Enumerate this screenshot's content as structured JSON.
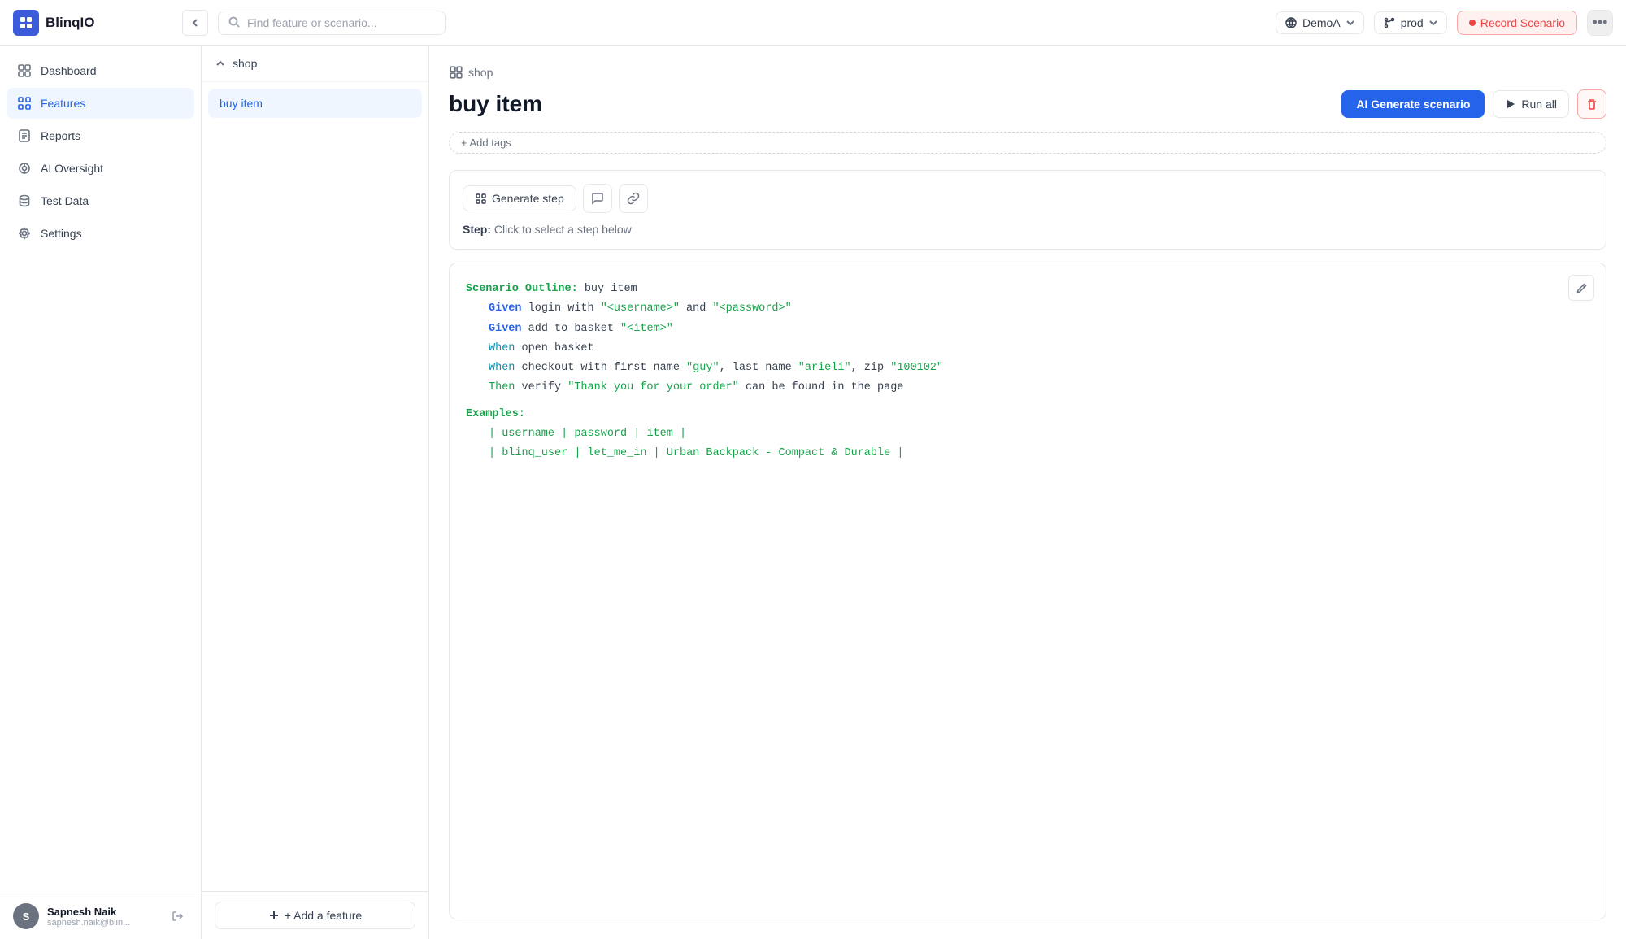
{
  "app": {
    "logo_text": "BlinqIO",
    "search_placeholder": "Find feature or scenario..."
  },
  "header": {
    "env_selector": "DemoA",
    "prod_selector": "prod",
    "record_btn": "Record Scenario",
    "more_icon": "•••"
  },
  "sidebar": {
    "items": [
      {
        "id": "dashboard",
        "label": "Dashboard",
        "active": false
      },
      {
        "id": "features",
        "label": "Features",
        "active": true
      },
      {
        "id": "reports",
        "label": "Reports",
        "active": false
      },
      {
        "id": "ai-oversight",
        "label": "AI Oversight",
        "active": false
      },
      {
        "id": "test-data",
        "label": "Test Data",
        "active": false
      },
      {
        "id": "settings",
        "label": "Settings",
        "active": false
      }
    ],
    "user": {
      "name": "Sapnesh Naik",
      "email": "sapnesh.naik@blin...",
      "initials": "S"
    }
  },
  "middle_panel": {
    "folder": "shop",
    "items": [
      {
        "label": "buy item"
      }
    ],
    "add_feature_label": "+ Add a feature"
  },
  "main": {
    "breadcrumb": "shop",
    "title": "buy item",
    "ai_generate_btn": "AI Generate scenario",
    "run_all_btn": "Run all",
    "add_tags_btn": "+ Add tags",
    "step_area": {
      "generate_step_btn": "Generate step",
      "step_hint_prefix": "Step:",
      "step_hint_text": "Click to select a step below"
    },
    "scenario": {
      "edit_icon": "✏",
      "outline_keyword": "Scenario Outline:",
      "outline_name": " buy item",
      "lines": [
        {
          "keyword": "Given",
          "text": " login with ",
          "string1": "\"<username>\"",
          "mid": " and ",
          "string2": "\"<password>\""
        },
        {
          "keyword": "Given",
          "text": " add to basket ",
          "string1": "\"<item>\""
        },
        {
          "keyword": "When",
          "text": " open basket"
        },
        {
          "keyword": "When",
          "text": " checkout with first name ",
          "string1": "\"guy\"",
          "mid": ", last name ",
          "string2": "\"arieli\"",
          "mid2": ", zip ",
          "string3": "\"100102\""
        },
        {
          "keyword": "Then",
          "text": " verify ",
          "string1": "\"Thank you for your order\"",
          "mid": " can be found in the page"
        }
      ],
      "examples_keyword": "Examples:",
      "table_header": "| username      | password    | item                              |",
      "table_row": "| blinq_user    | let_me_in   | Urban Backpack - Compact & Durable |"
    }
  }
}
